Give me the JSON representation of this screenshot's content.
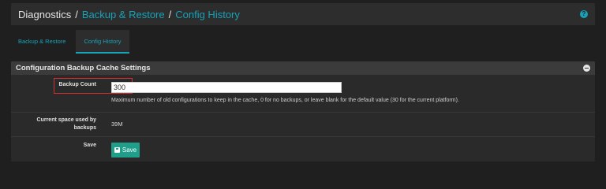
{
  "breadcrumb": {
    "first": "Diagnostics",
    "sep": "/",
    "second": "Backup & Restore",
    "third": "Config History"
  },
  "help_icon": "?",
  "tabs": [
    {
      "label": "Backup & Restore",
      "active": false
    },
    {
      "label": "Config History",
      "active": true
    }
  ],
  "panel": {
    "title": "Configuration Backup Cache Settings",
    "backup_count": {
      "label": "Backup Count",
      "value": "300",
      "help": "Maximum number of old configurations to keep in the cache, 0 for no backups, or leave blank for the default value (30 for the current platform)."
    },
    "current_space": {
      "label_line1": "Current space used by",
      "label_line2": "backups",
      "value": "39M"
    },
    "save": {
      "label": "Save",
      "button_label": "Save"
    }
  },
  "colors": {
    "accent": "#17a2b8",
    "button": "#1f9e8a",
    "highlight": "#d43030"
  },
  "icons": {
    "help": "help-circle-icon",
    "collapse": "minus-circle-icon",
    "save": "floppy-disk-icon"
  }
}
